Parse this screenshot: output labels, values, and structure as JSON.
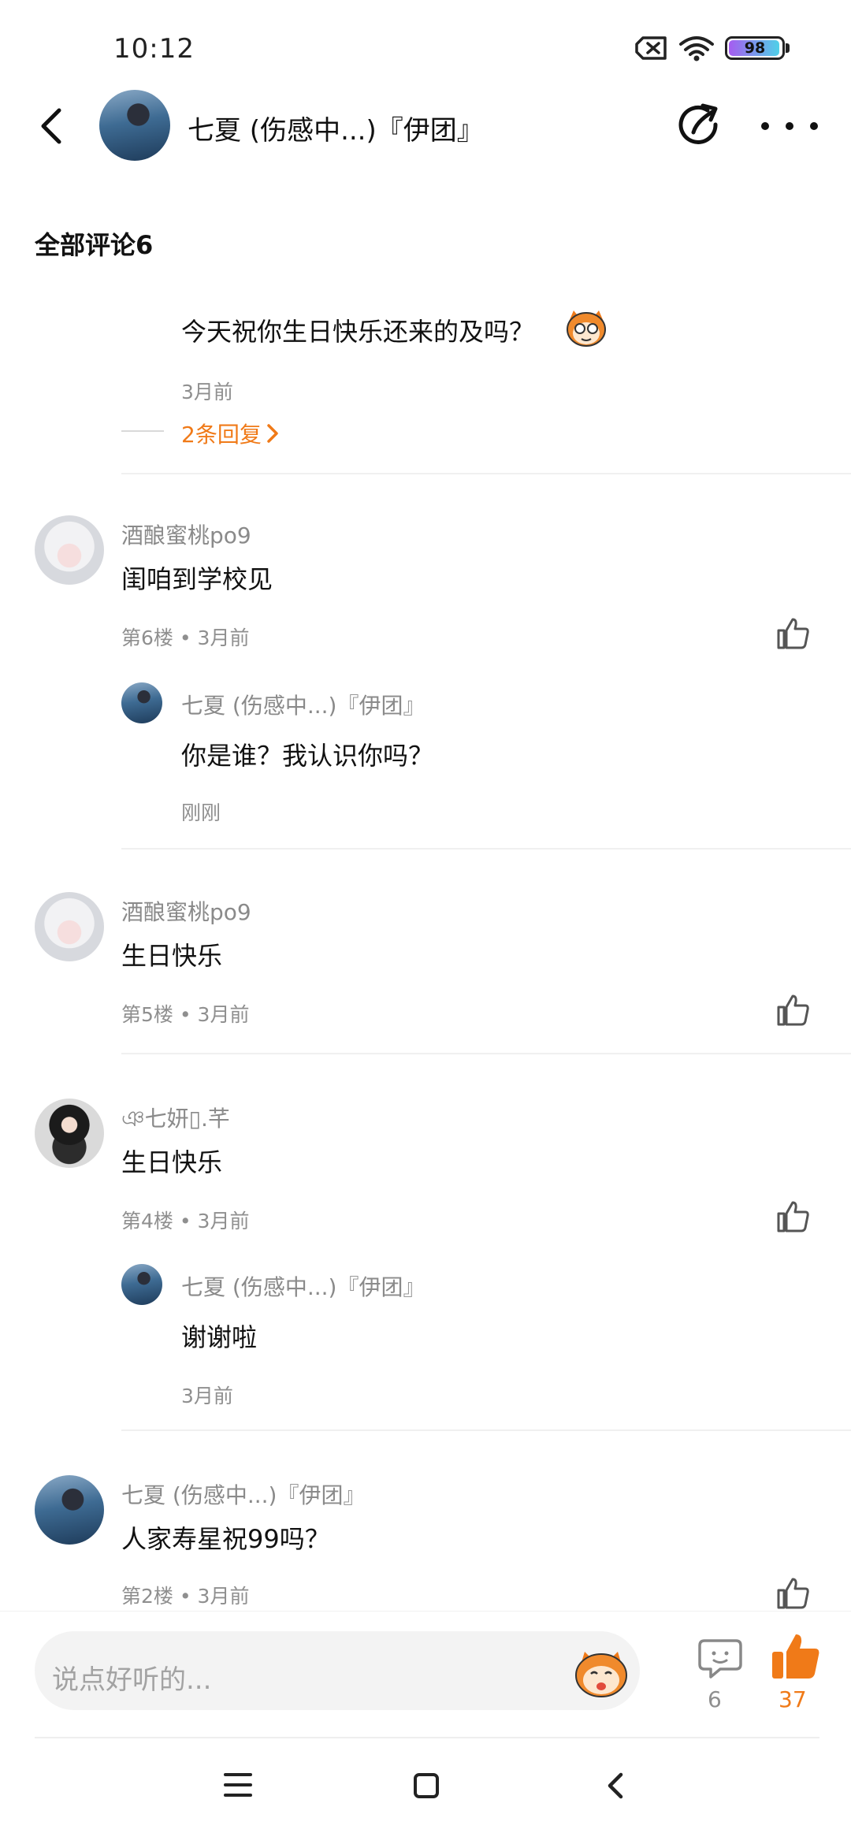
{
  "status_bar": {
    "time": "10:12",
    "battery": "98"
  },
  "header": {
    "title": "七夏 (伤感中...)『伊团』"
  },
  "comments_header": {
    "title": "全部评论6"
  },
  "top_reply": {
    "text": "今天祝你生日快乐还来的及吗？",
    "time": "3月前",
    "replies_link": "2条回复"
  },
  "comments": [
    {
      "user": "酒酿蜜桃po9",
      "text": "闺咱到学校见",
      "meta": "第6楼 • 3月前",
      "reply": {
        "user": "七夏 (伤感中...)『伊团』",
        "text": "你是谁？我认识你吗？",
        "time": "刚刚"
      }
    },
    {
      "user": "酒酿蜜桃po9",
      "text": "生日快乐",
      "meta": "第5楼 • 3月前"
    },
    {
      "user": "ঞ七妍▯.芊",
      "text": "生日快乐",
      "meta": "第4楼 • 3月前",
      "reply": {
        "user": "七夏 (伤感中...)『伊团』",
        "text": "谢谢啦",
        "time": "3月前"
      }
    },
    {
      "user": "七夏 (伤感中...)『伊团』",
      "text": "人家寿星祝99吗？",
      "meta": "第2楼 • 3月前"
    }
  ],
  "input_bar": {
    "placeholder": "说点好听的...",
    "comment_count": "6",
    "like_count": "37"
  },
  "colors": {
    "accent": "#f07a18",
    "muted": "#8f8f8f",
    "divider": "#f0f0f0"
  },
  "icons": [
    "back-arrow-icon",
    "share-icon",
    "more-icon",
    "like-icon",
    "comment-icon",
    "thumb-up-icon",
    "mascot-icon",
    "menu-icon",
    "home-icon",
    "back-icon",
    "wifi-icon",
    "sim-icon"
  ]
}
